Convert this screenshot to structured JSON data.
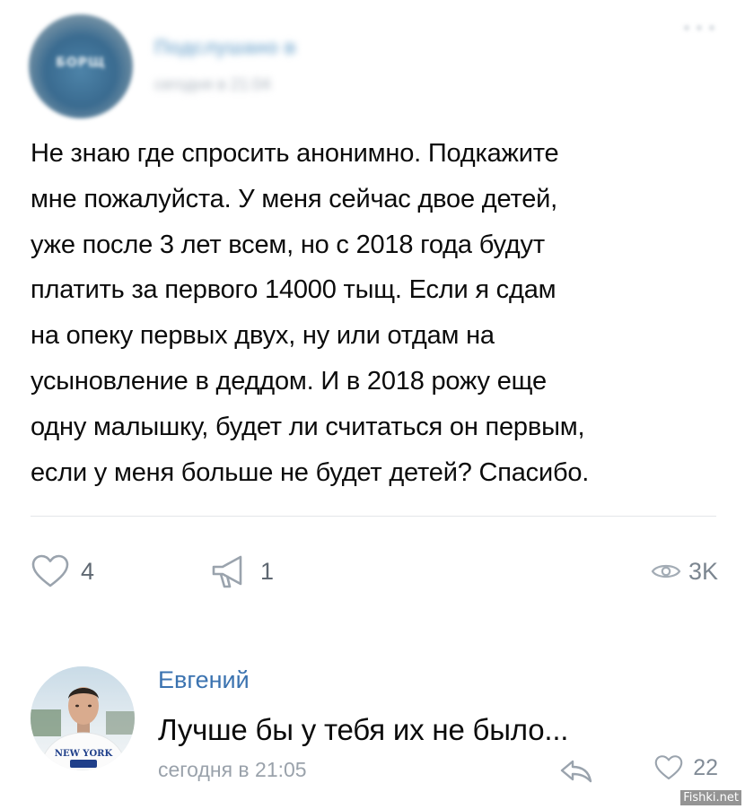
{
  "post": {
    "community_avatar_text": "БОРЩ",
    "community_name": "Подслушано в",
    "time": "сегодня в 21:04",
    "text": "Не знаю где спросить анонимно. Подкажите\nмне пожалуйста. У меня сейчас двое детей,\nуже после 3 лет всем, но с 2018 года будут\nплатить за первого 14000 тыщ. Если я сдам\nна опеку первых двух, ну или отдам на\nусыновление в деддом. И в 2018 рожу еще\nодну малышку, будет ли считаться он первым,\nесли у меня больше не будет детей? Спасибо.",
    "likes": "4",
    "shares": "1",
    "views": "3K"
  },
  "comment": {
    "author": "Евгений",
    "text": "Лучше бы у тебя их не было...",
    "time": "сегодня в 21:05",
    "likes": "22",
    "shirt_text": "NEW YORK"
  },
  "watermark": "Fishki.net",
  "colors": {
    "author_link": "#3b73b0",
    "icon_gray": "#828c97",
    "divider": "#e3e6e9"
  },
  "icons": [
    "heart-icon",
    "megaphone-share-icon",
    "eye-icon",
    "reply-arrow-icon"
  ]
}
